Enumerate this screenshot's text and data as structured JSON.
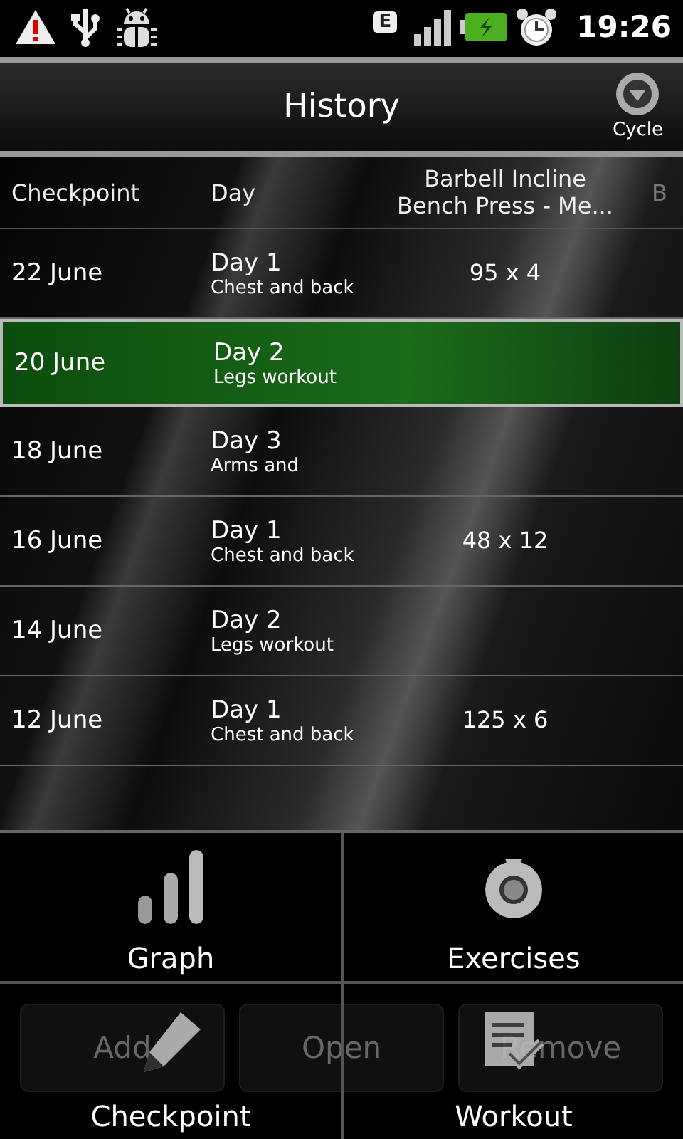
{
  "status_bar": {
    "network": "E",
    "time": "19:26"
  },
  "title_bar": {
    "title": "History",
    "cycle_button": "Cycle"
  },
  "table": {
    "columns": [
      "Checkpoint",
      "Day",
      "Barbell Incline Bench Press - Me...",
      "B"
    ],
    "rows": [
      {
        "checkpoint": "22 June",
        "day": "Day 1",
        "workout": "Chest and back",
        "column_3": "95 x 4",
        "selected": false
      },
      {
        "checkpoint": "20 June",
        "day": "Day 2",
        "workout": "Legs workout",
        "selected": true
      },
      {
        "checkpoint": "18 June",
        "day": "Day 3",
        "workout": "Arms and",
        "selected": false
      },
      {
        "checkpoint": "16 June",
        "day": "Day 1",
        "workout": "Chest and back",
        "column_3": "48 x 12",
        "selected": false
      },
      {
        "checkpoint": "14 June",
        "day": "Day 2",
        "workout": "Legs workout",
        "selected": false
      },
      {
        "checkpoint": "12 June",
        "day": "Day 1",
        "workout": "Chest and back",
        "column_3": "125 x 6",
        "selected": false
      }
    ]
  },
  "buttons": [
    "Add",
    "Open",
    "Remove"
  ],
  "menu": [
    {
      "label": "Graph",
      "kind": "graph"
    },
    {
      "label": "Exercises",
      "kind": "exercises"
    },
    {
      "label": "Checkpoint",
      "kind": "checkpoint"
    },
    {
      "label": "Workout",
      "kind": "workout"
    }
  ]
}
